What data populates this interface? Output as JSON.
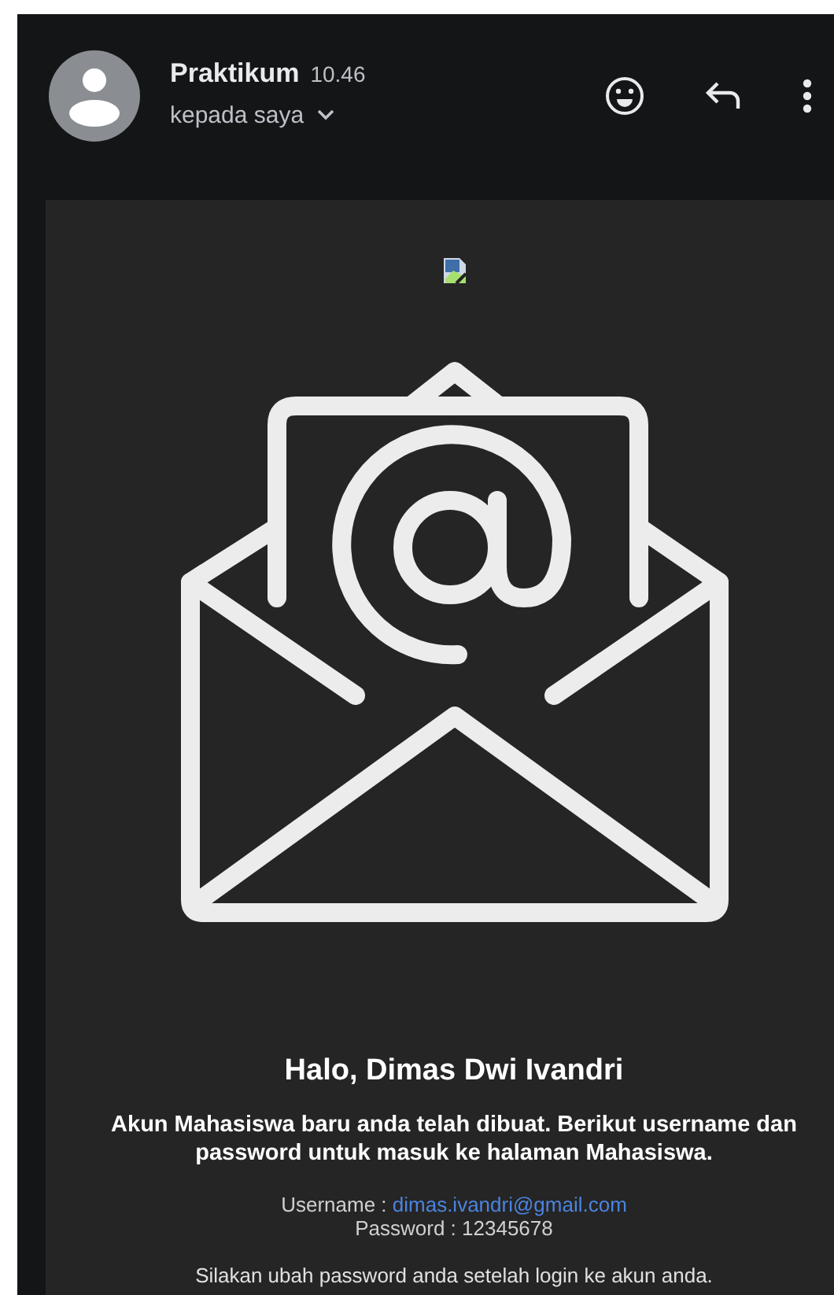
{
  "sender": {
    "name": "Praktikum",
    "time": "10.46",
    "recipient": "kepada saya"
  },
  "body": {
    "greeting": "Halo, Dimas Dwi Ivandri",
    "intro": "Akun Mahasiswa baru anda telah dibuat. Berikut username dan password untuk masuk ke halaman Mahasiswa.",
    "credentials": [
      {
        "label": "Username :",
        "value": "dimas.ivandri@gmail.com",
        "kind": "link"
      },
      {
        "label": "Password :",
        "value": "12345678",
        "kind": "plain"
      }
    ],
    "note": "Silakan ubah password anda setelah login ke akun anda."
  }
}
